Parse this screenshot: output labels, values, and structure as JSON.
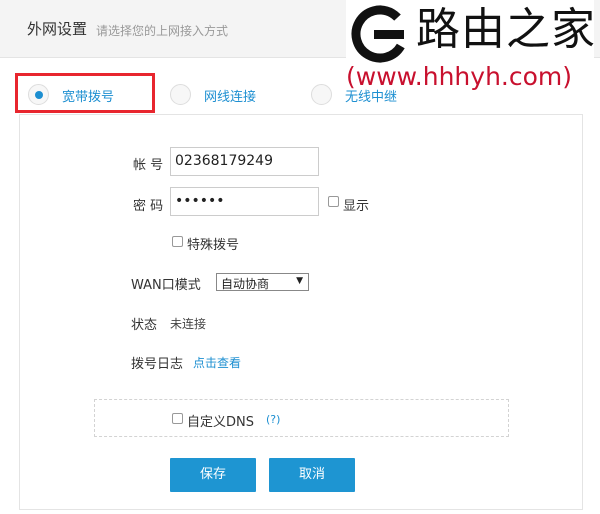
{
  "header": {
    "title": "外网设置",
    "subtitle": "请选择您的上网接入方式"
  },
  "watermark": {
    "name": "路由之家",
    "url": "(www.hhhyh.com)"
  },
  "tabs": [
    {
      "label": "宽带拨号",
      "checked": true
    },
    {
      "label": "网线连接",
      "checked": false
    },
    {
      "label": "无线中继",
      "checked": false
    }
  ],
  "form": {
    "account_label": "帐 号",
    "account_value": "02368179249",
    "password_label": "密 码",
    "password_value": "••••••",
    "show_label": "显示",
    "special_dial_label": "特殊拨号",
    "wan_mode_label": "WAN口模式",
    "wan_mode_value": "自动协商",
    "status_label": "状态",
    "status_value": "未连接",
    "dial_log_label": "拨号日志",
    "dial_log_link": "点击查看",
    "custom_dns_label": "自定义DNS",
    "custom_dns_help": "(?)"
  },
  "buttons": {
    "save": "保存",
    "cancel": "取消"
  },
  "colors": {
    "accent": "#1e95d2",
    "highlight": "#e8262e",
    "watermark_url": "#c8102e"
  }
}
